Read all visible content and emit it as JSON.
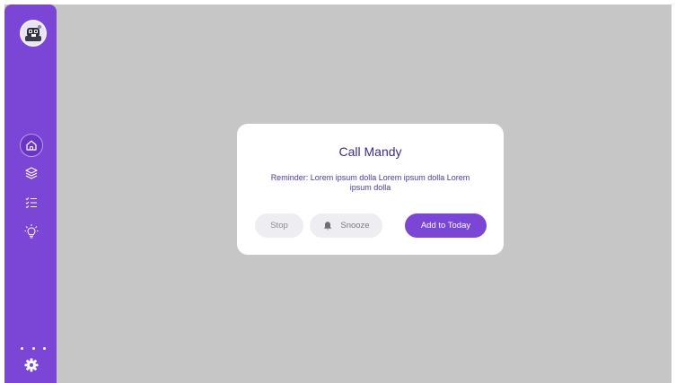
{
  "sidebar": {
    "avatar_alt": "avatar",
    "nav": [
      {
        "icon": "home-icon",
        "active": true
      },
      {
        "icon": "layers-icon",
        "active": false
      },
      {
        "icon": "checklist-icon",
        "active": false
      },
      {
        "icon": "lightbulb-icon",
        "active": false
      }
    ],
    "more_icon": "more-dots-icon",
    "settings_icon": "gear-icon"
  },
  "dialog": {
    "title": "Call Mandy",
    "reminder": "Reminder: Lorem ipsum dolla Lorem ipsum dolla Lorem ipsum dolla",
    "stop_label": "Stop",
    "snooze_label": "Snooze",
    "snooze_icon": "bell-icon",
    "add_label": "Add to Today"
  },
  "colors": {
    "sidebar": "#7b45d6",
    "backdrop": "#c6c6c6",
    "accent": "#7b45d6",
    "title_text": "#3e2a87"
  }
}
